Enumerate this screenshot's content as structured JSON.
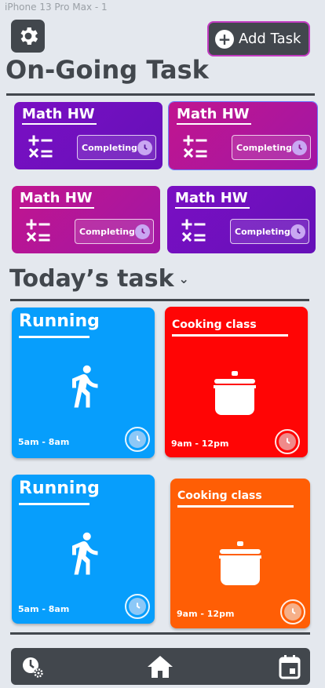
{
  "frame_label": "iPhone 13 Pro Max - 1",
  "header": {
    "settings_icon": "gear-icon",
    "add_task": {
      "icon": "plus-circle-icon",
      "label": "Add Task"
    }
  },
  "ongoing": {
    "title": "On-Going Task",
    "tasks": [
      {
        "title": "Math HW",
        "icon": "math-operators-icon",
        "status": "Completing",
        "status_icon": "clock-icon",
        "color": "#7a0fc3"
      },
      {
        "title": "Math HW",
        "icon": "math-operators-icon",
        "status": "Completing",
        "status_icon": "clock-icon",
        "color": "#c1158f"
      },
      {
        "title": "Math HW",
        "icon": "math-operators-icon",
        "status": "Completing",
        "status_icon": "clock-icon",
        "color": "#c1158f"
      },
      {
        "title": "Math HW",
        "icon": "math-operators-icon",
        "status": "Completing",
        "status_icon": "clock-icon",
        "color": "#7a0fc3"
      }
    ]
  },
  "today": {
    "title": "Today’s task",
    "chevron_icon": "chevron-down-icon",
    "tasks": [
      {
        "title": "Running",
        "icon": "running-person-icon",
        "time": "5am - 8am",
        "color": "#079efc"
      },
      {
        "title": "Cooking class",
        "icon": "cooking-pot-icon",
        "time": "9am - 12pm",
        "color": "#ff0505"
      },
      {
        "title": "Running",
        "icon": "running-person-icon",
        "time": "5am - 8am",
        "color": "#079efc"
      },
      {
        "title": "Cooking class",
        "icon": "cooking-pot-icon",
        "time": "9am - 12pm",
        "color": "#ff5e05"
      }
    ]
  },
  "nav": {
    "items": [
      {
        "icon": "clock-settings-icon"
      },
      {
        "icon": "home-icon"
      },
      {
        "icon": "calendar-icon"
      }
    ]
  }
}
